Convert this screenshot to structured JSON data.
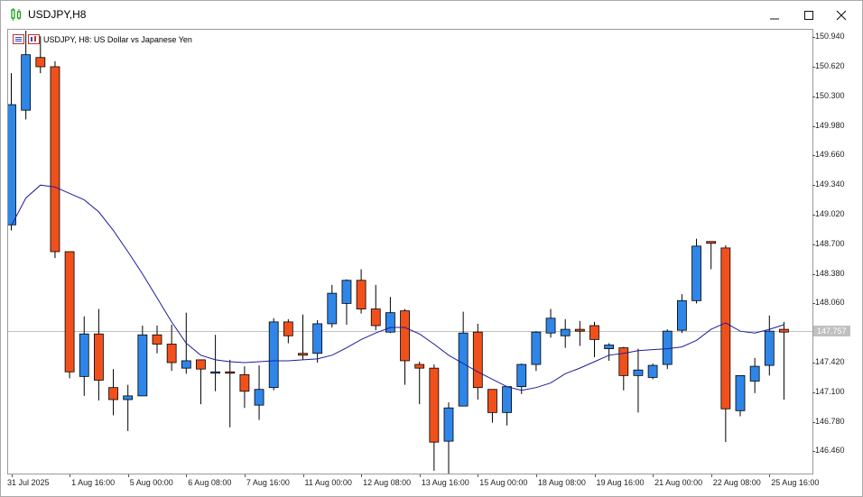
{
  "window": {
    "title": "USDJPY,H8",
    "buttons": [
      "minimize",
      "maximize",
      "close"
    ]
  },
  "legend": {
    "text": "USDJPY, H8:  US Dollar vs Japanese Yen"
  },
  "price_axis": {
    "labels": [
      "150.940",
      "150.620",
      "150.300",
      "149.980",
      "149.660",
      "149.340",
      "149.020",
      "148.700",
      "148.380",
      "148.060",
      "147.420",
      "147.100",
      "146.780",
      "146.460"
    ],
    "current_price": "147.757"
  },
  "time_axis": {
    "labels": [
      "31 Jul 2025",
      "1 Aug 16:00",
      "5 Aug 00:00",
      "6 Aug 08:00",
      "7 Aug 16:00",
      "11 Aug 00:00",
      "12 Aug 08:00",
      "13 Aug 16:00",
      "15 Aug 00:00",
      "18 Aug 08:00",
      "19 Aug 16:00",
      "21 Aug 00:00",
      "22 Aug 08:00",
      "25 Aug 16:00"
    ]
  },
  "colors": {
    "bull": "#2f86e8",
    "bear": "#f0511c",
    "wick": "#000000",
    "ma_line": "#1c1c9c",
    "current_price_line": "#c0c0c0"
  },
  "chart_data": {
    "type": "candlestick",
    "symbol": "USDJPY",
    "timeframe": "H8",
    "ylim": [
      146.22,
      151.02
    ],
    "candles": [
      {
        "o": 148.91,
        "h": 150.55,
        "l": 148.85,
        "c": 150.21
      },
      {
        "o": 150.15,
        "h": 151.01,
        "l": 150.05,
        "c": 150.75
      },
      {
        "o": 150.72,
        "h": 150.95,
        "l": 150.55,
        "c": 150.62
      },
      {
        "o": 150.62,
        "h": 150.68,
        "l": 148.55,
        "c": 148.62
      },
      {
        "o": 148.62,
        "h": 148.62,
        "l": 147.25,
        "c": 147.32
      },
      {
        "o": 147.27,
        "h": 147.92,
        "l": 147.06,
        "c": 147.73
      },
      {
        "o": 147.73,
        "h": 148.0,
        "l": 147.01,
        "c": 147.23
      },
      {
        "o": 147.15,
        "h": 147.35,
        "l": 146.85,
        "c": 147.02
      },
      {
        "o": 147.02,
        "h": 147.18,
        "l": 146.68,
        "c": 147.06
      },
      {
        "o": 147.06,
        "h": 147.82,
        "l": 147.06,
        "c": 147.72
      },
      {
        "o": 147.72,
        "h": 147.82,
        "l": 147.52,
        "c": 147.62
      },
      {
        "o": 147.62,
        "h": 147.83,
        "l": 147.33,
        "c": 147.42
      },
      {
        "o": 147.36,
        "h": 147.96,
        "l": 147.3,
        "c": 147.44
      },
      {
        "o": 147.45,
        "h": 147.45,
        "l": 146.97,
        "c": 147.35
      },
      {
        "o": 147.32,
        "h": 147.72,
        "l": 147.11,
        "c": 147.32
      },
      {
        "o": 147.32,
        "h": 147.45,
        "l": 146.72,
        "c": 147.31
      },
      {
        "o": 147.29,
        "h": 147.38,
        "l": 146.93,
        "c": 147.11
      },
      {
        "o": 146.96,
        "h": 147.39,
        "l": 146.8,
        "c": 147.13
      },
      {
        "o": 147.15,
        "h": 147.9,
        "l": 147.12,
        "c": 147.86
      },
      {
        "o": 147.86,
        "h": 147.89,
        "l": 147.63,
        "c": 147.71
      },
      {
        "o": 147.52,
        "h": 147.94,
        "l": 147.45,
        "c": 147.5
      },
      {
        "o": 147.52,
        "h": 147.88,
        "l": 147.42,
        "c": 147.84
      },
      {
        "o": 147.84,
        "h": 148.26,
        "l": 147.8,
        "c": 148.17
      },
      {
        "o": 148.06,
        "h": 148.32,
        "l": 147.83,
        "c": 148.31
      },
      {
        "o": 148.31,
        "h": 148.43,
        "l": 147.95,
        "c": 148.0
      },
      {
        "o": 148.0,
        "h": 148.26,
        "l": 147.77,
        "c": 147.82
      },
      {
        "o": 147.75,
        "h": 148.13,
        "l": 147.74,
        "c": 147.96
      },
      {
        "o": 147.98,
        "h": 148.0,
        "l": 147.18,
        "c": 147.44
      },
      {
        "o": 147.4,
        "h": 147.43,
        "l": 146.97,
        "c": 147.36
      },
      {
        "o": 147.36,
        "h": 147.4,
        "l": 146.25,
        "c": 146.56
      },
      {
        "o": 146.57,
        "h": 146.99,
        "l": 146.16,
        "c": 146.93
      },
      {
        "o": 146.95,
        "h": 147.97,
        "l": 146.95,
        "c": 147.74
      },
      {
        "o": 147.75,
        "h": 147.84,
        "l": 147.02,
        "c": 147.15
      },
      {
        "o": 147.13,
        "h": 147.13,
        "l": 146.77,
        "c": 146.88
      },
      {
        "o": 146.88,
        "h": 147.16,
        "l": 146.74,
        "c": 147.16
      },
      {
        "o": 147.16,
        "h": 147.41,
        "l": 147.08,
        "c": 147.4
      },
      {
        "o": 147.4,
        "h": 147.76,
        "l": 147.33,
        "c": 147.75
      },
      {
        "o": 147.74,
        "h": 148.0,
        "l": 147.69,
        "c": 147.9
      },
      {
        "o": 147.71,
        "h": 147.89,
        "l": 147.58,
        "c": 147.78
      },
      {
        "o": 147.78,
        "h": 147.87,
        "l": 147.6,
        "c": 147.76
      },
      {
        "o": 147.82,
        "h": 147.86,
        "l": 147.48,
        "c": 147.67
      },
      {
        "o": 147.57,
        "h": 147.63,
        "l": 147.44,
        "c": 147.61
      },
      {
        "o": 147.58,
        "h": 147.59,
        "l": 147.12,
        "c": 147.28
      },
      {
        "o": 147.28,
        "h": 147.57,
        "l": 146.88,
        "c": 147.34
      },
      {
        "o": 147.26,
        "h": 147.41,
        "l": 147.24,
        "c": 147.39
      },
      {
        "o": 147.4,
        "h": 147.78,
        "l": 147.35,
        "c": 147.76
      },
      {
        "o": 147.77,
        "h": 148.16,
        "l": 147.74,
        "c": 148.09
      },
      {
        "o": 148.09,
        "h": 148.76,
        "l": 148.06,
        "c": 148.68
      },
      {
        "o": 148.73,
        "h": 148.73,
        "l": 148.43,
        "c": 148.71
      },
      {
        "o": 148.66,
        "h": 148.69,
        "l": 146.56,
        "c": 146.92
      },
      {
        "o": 146.9,
        "h": 147.21,
        "l": 146.84,
        "c": 147.28
      },
      {
        "o": 147.22,
        "h": 147.47,
        "l": 147.09,
        "c": 147.38
      },
      {
        "o": 147.39,
        "h": 147.93,
        "l": 147.28,
        "c": 147.76
      },
      {
        "o": 147.78,
        "h": 147.86,
        "l": 147.02,
        "c": 147.75
      }
    ],
    "moving_average": [
      148.9,
      149.2,
      149.34,
      149.32,
      149.25,
      149.18,
      149.05,
      148.85,
      148.62,
      148.38,
      148.12,
      147.86,
      147.63,
      147.5,
      147.45,
      147.43,
      147.42,
      147.43,
      147.44,
      147.44,
      147.45,
      147.46,
      147.5,
      147.58,
      147.67,
      147.74,
      147.8,
      147.8,
      147.73,
      147.62,
      147.5,
      147.41,
      147.32,
      147.24,
      147.16,
      147.12,
      147.15,
      147.2,
      147.3,
      147.36,
      147.43,
      147.5,
      147.52,
      147.55,
      147.56,
      147.57,
      147.59,
      147.66,
      147.78,
      147.85,
      147.76,
      147.74,
      147.78,
      147.83
    ]
  }
}
